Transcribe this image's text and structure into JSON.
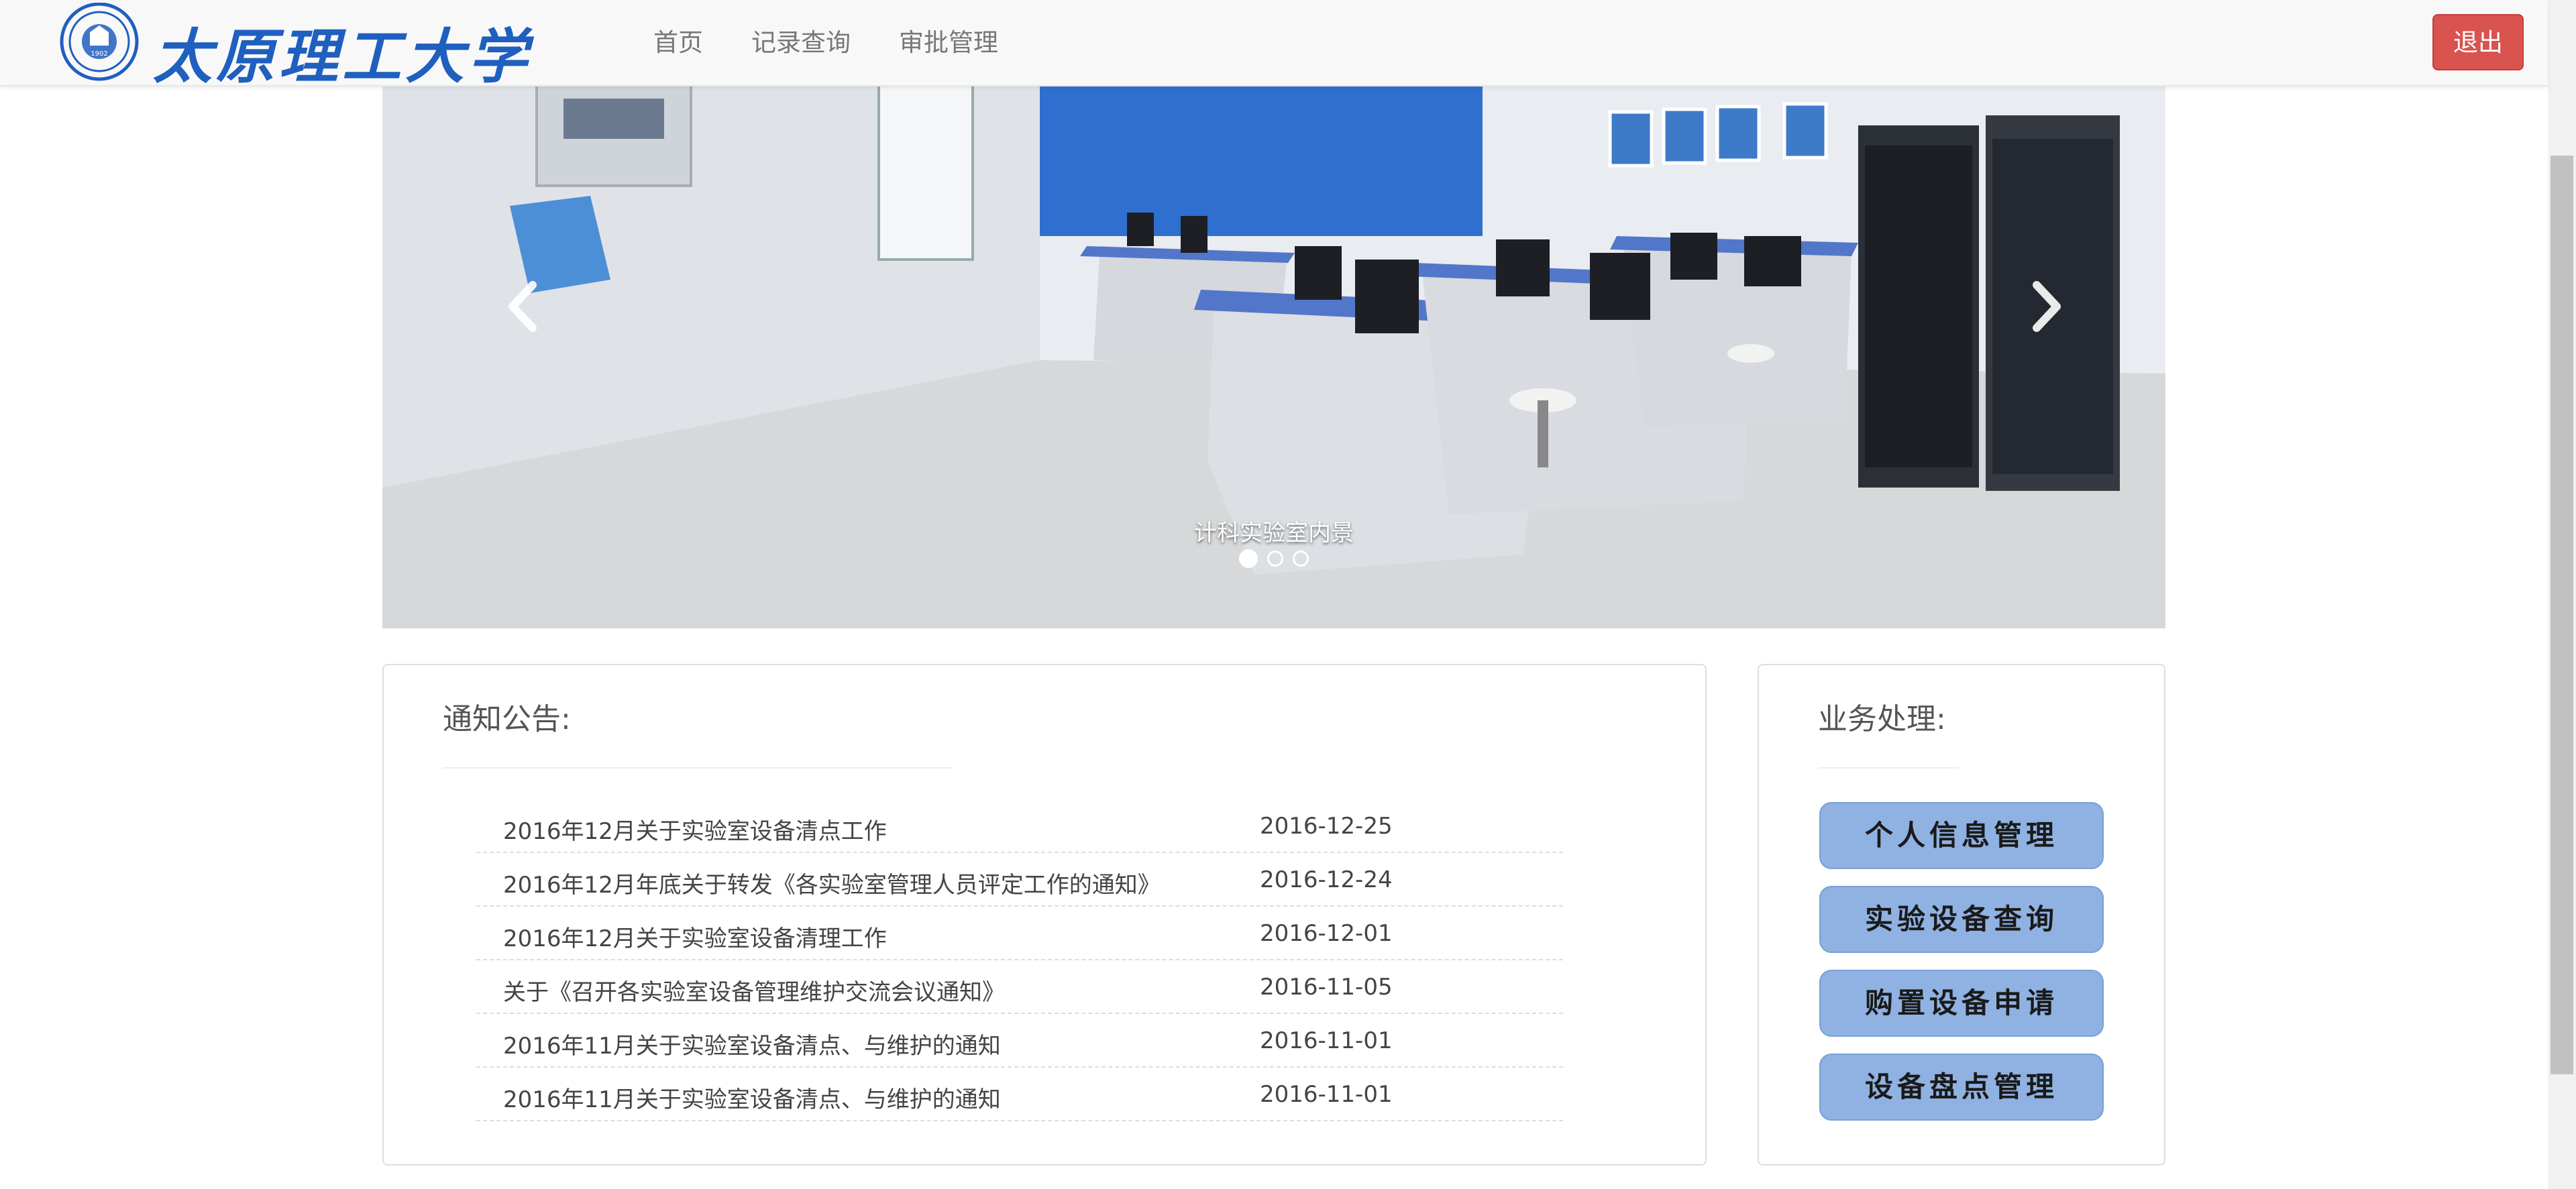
{
  "header": {
    "logo_text": "太原理工大学",
    "nav": [
      "首页",
      "记录查询",
      "审批管理"
    ],
    "logout_label": "退出"
  },
  "carousel": {
    "caption": "计科实验室内景",
    "slide_count": 3,
    "active_index": 0
  },
  "notice": {
    "title": "通知公告:",
    "items": [
      {
        "title": "2016年12月关于实验室设备清点工作",
        "date": "2016-12-25"
      },
      {
        "title": "2016年12月年底关于转发《各实验室管理人员评定工作的通知》",
        "date": "2016-12-24"
      },
      {
        "title": "2016年12月关于实验室设备清理工作",
        "date": "2016-12-01"
      },
      {
        "title": "关于《召开各实验室设备管理维护交流会议通知》",
        "date": "2016-11-05"
      },
      {
        "title": "2016年11月关于实验室设备清点、与维护的通知",
        "date": "2016-11-01"
      },
      {
        "title": "2016年11月关于实验室设备清点、与维护的通知",
        "date": "2016-11-01"
      }
    ]
  },
  "business": {
    "title": "业务处理:",
    "buttons": [
      "个人信息管理",
      "实验设备查询",
      "购置设备申请",
      "设备盘点管理"
    ]
  },
  "colors": {
    "logo_blue": "#1f5fbf",
    "logout_red": "#d9534f",
    "button_blue": "#8fb2e2"
  }
}
